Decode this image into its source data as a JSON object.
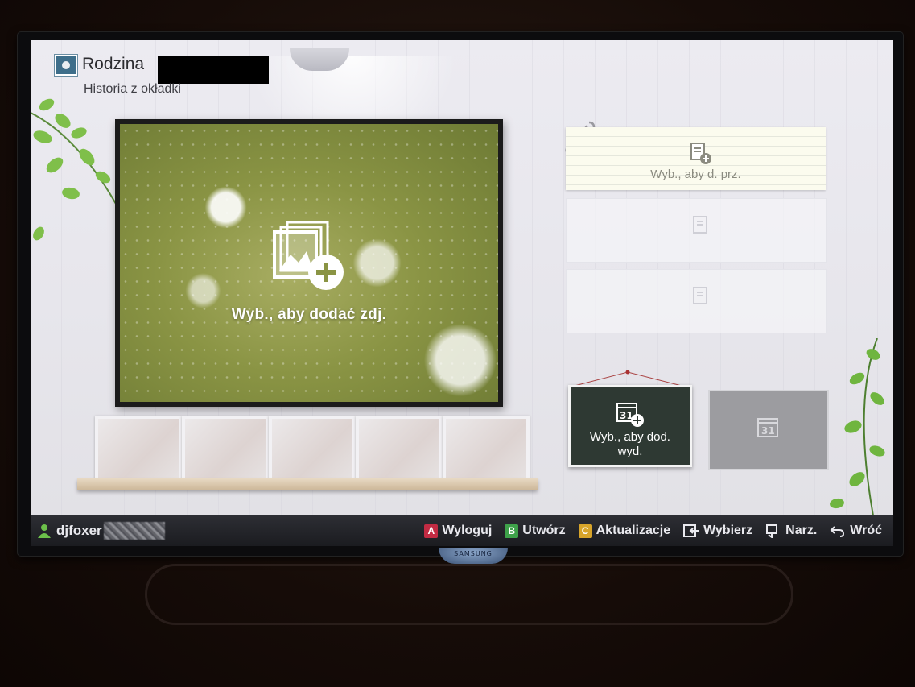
{
  "header": {
    "album_title": "Rodzina",
    "album_subtitle": "Historia z okładki"
  },
  "main_photo": {
    "add_label": "Wyb., aby dodać zdj."
  },
  "notes": {
    "add_note_label": "Wyb., aby d. prz."
  },
  "events": {
    "calendar_day": "31",
    "add_event_label_line1": "Wyb., aby dod.",
    "add_event_label_line2": "wyd."
  },
  "bottom_bar": {
    "username": "djfoxer",
    "actions": [
      {
        "key": "A",
        "label": "Wyloguj",
        "color": "#c22b43"
      },
      {
        "key": "B",
        "label": "Utwórz",
        "color": "#3ea24a"
      },
      {
        "key": "C",
        "label": "Aktualizacje",
        "color": "#d7a42a"
      },
      {
        "icon": "enter-icon",
        "label": "Wybierz"
      },
      {
        "icon": "tools-icon",
        "label": "Narz."
      },
      {
        "icon": "return-icon",
        "label": "Wróć"
      }
    ]
  },
  "tv": {
    "brand": "SAMSUNG"
  }
}
